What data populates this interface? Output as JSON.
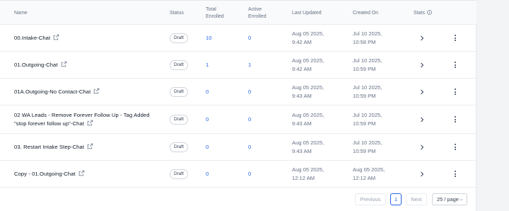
{
  "table": {
    "headers": {
      "name": "Name",
      "status": "Status",
      "total_enrolled_1": "Total",
      "total_enrolled_2": "Enrolled",
      "active_enrolled_1": "Active",
      "active_enrolled_2": "Enrolled",
      "last_updated": "Last Updated",
      "created_on": "Created On",
      "stats": "Stats"
    },
    "rows": [
      {
        "name": "00.Intake-Chat",
        "name_line2": "",
        "status": "Draft",
        "total": "10",
        "active": "0",
        "updated_1": "Aug 05 2025,",
        "updated_2": "9:42 AM",
        "created_1": "Jul 10 2025,",
        "created_2": "10:58 PM"
      },
      {
        "name": "01.Outgoing-Chat",
        "name_line2": "",
        "status": "Draft",
        "total": "1",
        "active": "1",
        "updated_1": "Aug 05 2025,",
        "updated_2": "9:42 AM",
        "created_1": "Jul 10 2025,",
        "created_2": "10:59 PM"
      },
      {
        "name": "01A.Outgoing-No Contact-Chat",
        "name_line2": "",
        "status": "Draft",
        "total": "0",
        "active": "0",
        "updated_1": "Aug 05 2025,",
        "updated_2": "9:43 AM",
        "created_1": "Jul 10 2025,",
        "created_2": "10:59 PM"
      },
      {
        "name": "02 WA Leads - Remove Forever Follow Up - Tag Added",
        "name_line2": "\"stop forever follow up\"-Chat",
        "status": "Draft",
        "total": "0",
        "active": "0",
        "updated_1": "Aug 05 2025,",
        "updated_2": "9:43 AM",
        "created_1": "Jul 10 2025,",
        "created_2": "10:59 PM"
      },
      {
        "name": "03. Restart Intake Step-Chat",
        "name_line2": "",
        "status": "Draft",
        "total": "0",
        "active": "0",
        "updated_1": "Aug 05 2025,",
        "updated_2": "9:43 AM",
        "created_1": "Jul 10 2025,",
        "created_2": "10:59 PM"
      },
      {
        "name": "Copy - 01.Outgoing-Chat",
        "name_line2": "",
        "status": "Draft",
        "total": "0",
        "active": "0",
        "updated_1": "Aug 05 2025,",
        "updated_2": "12:12 AM",
        "created_1": "Aug 05 2025,",
        "created_2": "12:12 AM"
      }
    ]
  },
  "pagination": {
    "previous": "Previous",
    "current_page": "1",
    "next": "Next",
    "page_size": "25 / page"
  },
  "icons": {
    "external_link": "external-link-icon",
    "info": "info-icon",
    "chevron_right": "chevron-right-icon",
    "more": "more-vertical-icon",
    "caret_down": "chevron-down-icon"
  },
  "colors": {
    "link_blue": "#2563eb",
    "text_dark": "#101828",
    "text_muted": "#667085",
    "header_bg": "#f9fafb",
    "page_bg": "#f3f4f6"
  }
}
